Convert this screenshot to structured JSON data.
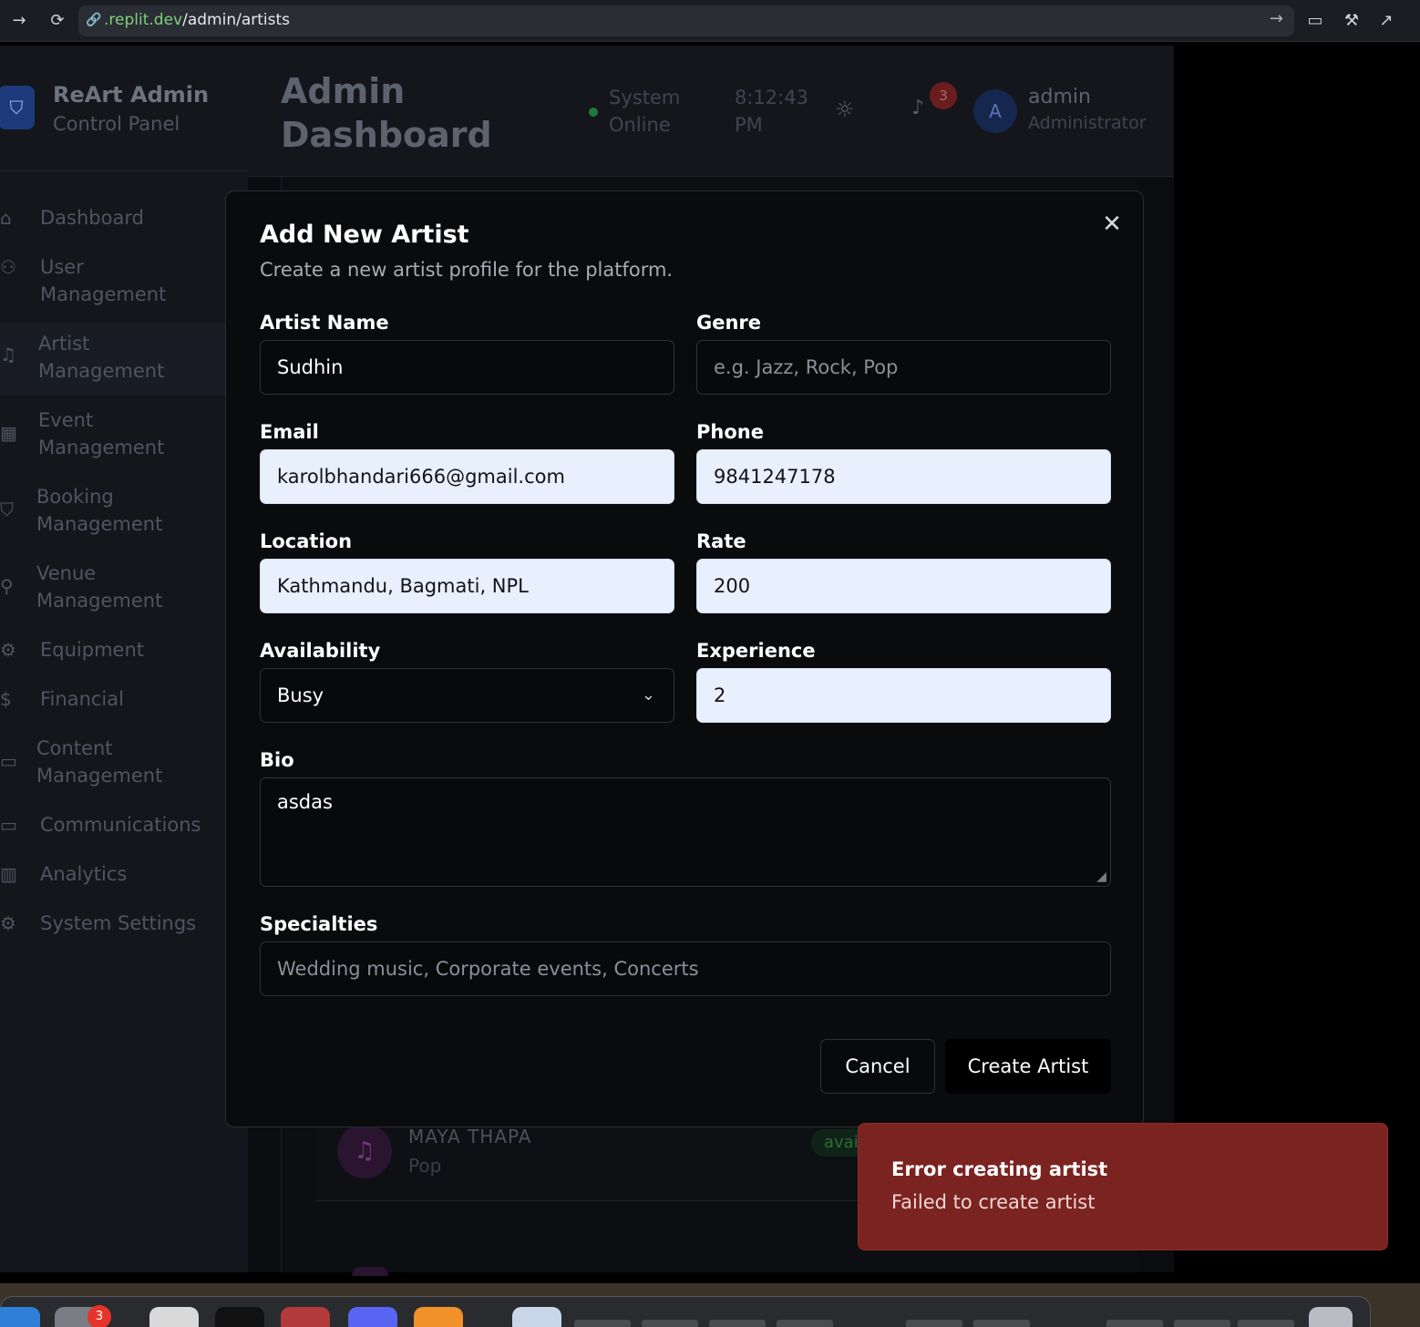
{
  "browser": {
    "url_domain": ".replit.dev",
    "url_path": "/admin/artists"
  },
  "sidebar": {
    "brand_title": "ReArt Admin",
    "brand_subtitle": "Control Panel",
    "items": [
      {
        "label": "Dashboard",
        "icon": "home-icon"
      },
      {
        "label": "User Management",
        "icon": "users-icon"
      },
      {
        "label": "Artist Management",
        "icon": "music-icon"
      },
      {
        "label": "Event Management",
        "icon": "calendar-icon"
      },
      {
        "label": "Booking Management",
        "icon": "shield-icon"
      },
      {
        "label": "Venue Management",
        "icon": "map-pin-icon"
      },
      {
        "label": "Equipment",
        "icon": "gear-icon"
      },
      {
        "label": "Financial",
        "icon": "dollar-icon"
      },
      {
        "label": "Content Management",
        "icon": "message-icon"
      },
      {
        "label": "Communications",
        "icon": "chat-icon"
      },
      {
        "label": "Analytics",
        "icon": "bar-chart-icon"
      },
      {
        "label": "System Settings",
        "icon": "settings-icon"
      }
    ]
  },
  "header": {
    "title": "Admin Dashboard",
    "status": "System Online",
    "time": "8:12:43 PM",
    "notification_count": "3",
    "avatar_letter": "A",
    "user_name": "admin",
    "user_role": "Administrator"
  },
  "table": {
    "row_name": "MAYA THAPA",
    "row_genre": "Pop",
    "row_status": "available"
  },
  "modal": {
    "title": "Add New Artist",
    "description": "Create a new artist profile for the platform.",
    "fields": {
      "artist_name": {
        "label": "Artist Name",
        "value": "Sudhin"
      },
      "genre": {
        "label": "Genre",
        "placeholder": "e.g. Jazz, Rock, Pop"
      },
      "email": {
        "label": "Email",
        "value": "karolbhandari666@gmail.com"
      },
      "phone": {
        "label": "Phone",
        "value": "9841247178"
      },
      "location": {
        "label": "Location",
        "value": "Kathmandu, Bagmati, NPL"
      },
      "rate": {
        "label": "Rate",
        "value": "200"
      },
      "availability": {
        "label": "Availability",
        "value": "Busy"
      },
      "experience": {
        "label": "Experience",
        "value": "2"
      },
      "bio": {
        "label": "Bio",
        "value": "asdas"
      },
      "specialties": {
        "label": "Specialties",
        "placeholder": "Wedding music, Corporate events, Concerts"
      }
    },
    "cancel_label": "Cancel",
    "create_label": "Create Artist"
  },
  "toast": {
    "title": "Error creating artist",
    "description": "Failed to create artist"
  },
  "dock": {
    "badge_count": "3"
  },
  "colors": {
    "toast_bg": "#7b2320",
    "autofill_bg": "#e8effd",
    "url_domain": "#7fd07a"
  }
}
